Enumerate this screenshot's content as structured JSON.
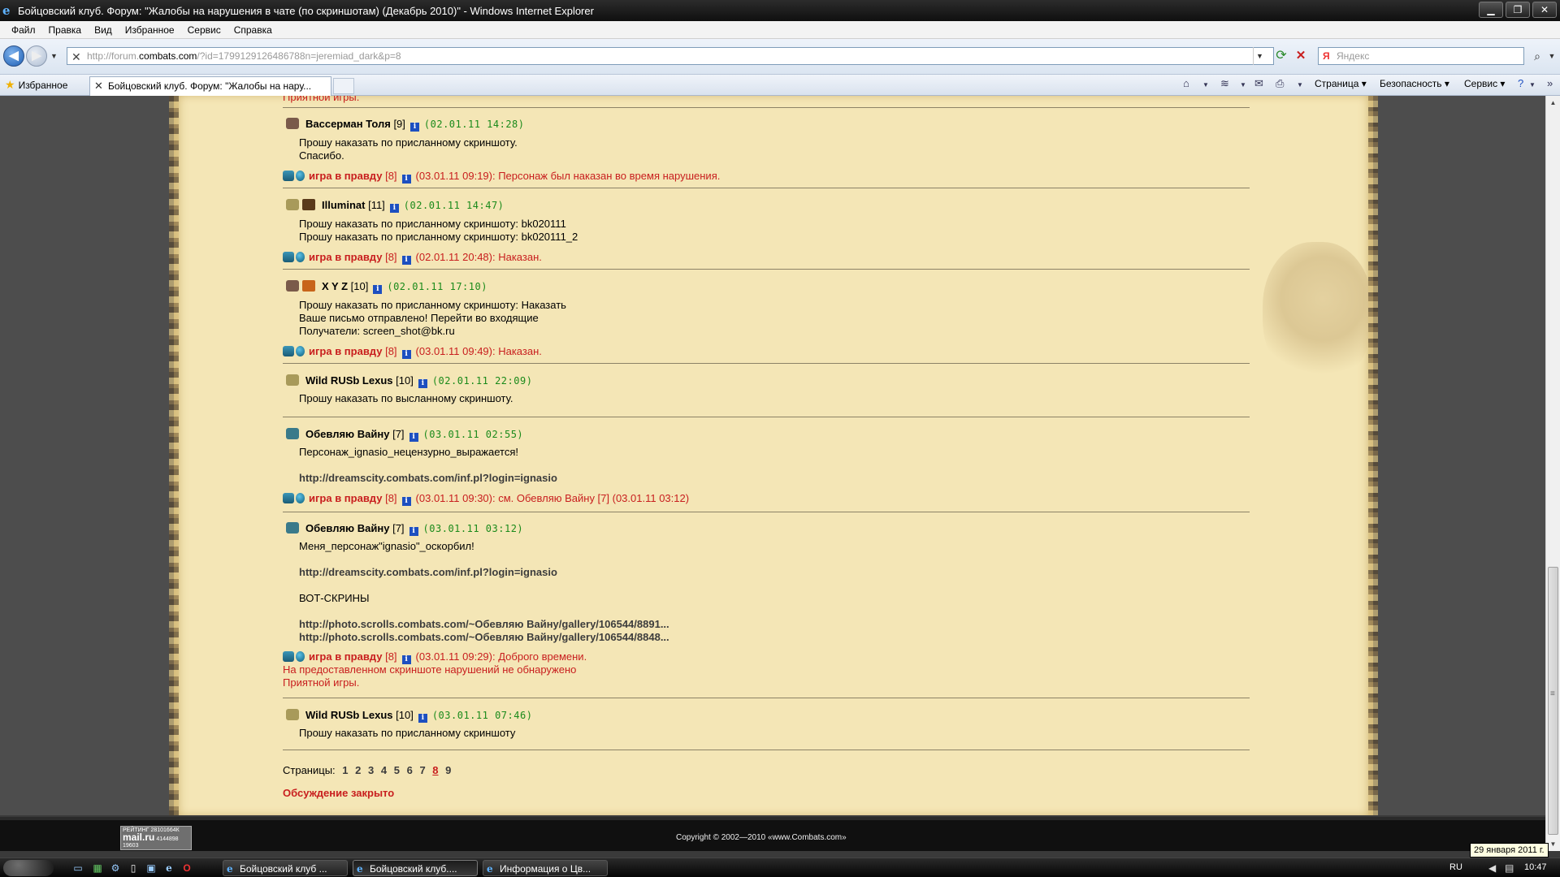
{
  "window": {
    "title": "Бойцовский клуб. Форум: \"Жалобы на нарушения в чате (по скриншотам) (Декабрь 2010)\" - Windows Internet Explorer"
  },
  "menu": [
    "Файл",
    "Правка",
    "Вид",
    "Избранное",
    "Сервис",
    "Справка"
  ],
  "address": {
    "prefix": "http://forum.",
    "host": "combats.com",
    "suffix": "/?id=1799129126486788n=jeremiad_dark&p=8",
    "search_placeholder": "Яндекс"
  },
  "tabs": {
    "favorites_label": "Избранное",
    "active_tab": "Бойцовский клуб. Форум: \"Жалобы на нару..."
  },
  "commandbar": {
    "page": "Страница",
    "security": "Безопасность",
    "service": "Сервис"
  },
  "forum": {
    "top_cut": "Приятной игры.",
    "posts": [
      {
        "author": "Вассерман Толя",
        "level": "[9]",
        "date": "(02.01.11 14:28)",
        "body": "Прошу наказать по присланному скриншоту.\nСпасибо.",
        "reply": {
          "moderator": "игра в правду",
          "level": "[8]",
          "text": "(03.01.11 09:19): Персонаж был наказан во время нарушения."
        }
      },
      {
        "author": "Illuminat",
        "level": "[11]",
        "date": "(02.01.11 14:47)",
        "body": "Прошу наказать по присланному скриншоту: bk020111\nПрошу наказать по присланному скриншоту: bk020111_2",
        "reply": {
          "moderator": "игра в правду",
          "level": "[8]",
          "text": "(02.01.11 20:48): Наказан."
        }
      },
      {
        "author": "X Y Z",
        "level": "[10]",
        "date": "(02.01.11 17:10)",
        "body": "Прошу наказать по присланному скриншоту: Наказать\nВаше письмо отправлено! Перейти во входящие\nПолучатели: screen_shot@bk.ru",
        "reply": {
          "moderator": "игра в правду",
          "level": "[8]",
          "text": "(03.01.11 09:49): Наказан."
        }
      },
      {
        "author": "Wild RUSb Lexus",
        "level": "[10]",
        "date": "(02.01.11 22:09)",
        "body": "Прошу наказать по высланному скриншоту."
      },
      {
        "author": "Обевляю Вайну",
        "level": "[7]",
        "date": "(03.01.11 02:55)",
        "body": "Персонаж_ignasio_нецензурно_выражается!",
        "link1": "http://dreamscity.combats.com/inf.pl?login=ignasio",
        "reply": {
          "moderator": "игра в правду",
          "level": "[8]",
          "text": "(03.01.11 09:30): см. Обевляю Вайну [7]   (03.01.11 03:12)"
        }
      },
      {
        "author": "Обевляю Вайну",
        "level": "[7]",
        "date": "(03.01.11 03:12)",
        "body": "Меня_персонаж\"ignasio\"_оскорбил!",
        "link1": "http://dreamscity.combats.com/inf.pl?login=ignasio",
        "screens_label": "ВОТ-СКРИНЫ",
        "link2": "http://photo.scrolls.combats.com/~Обевляю Вайну/gallery/106544/8891...",
        "link3": "http://photo.scrolls.combats.com/~Обевляю Вайну/gallery/106544/8848...",
        "reply": {
          "moderator": "игра в правду",
          "level": "[8]",
          "text": "(03.01.11 09:29): Доброго времени.",
          "extra": "На предоставленном скриншоте нарушений не обнаружено\nПриятной игры."
        }
      },
      {
        "author": "Wild RUSb Lexus",
        "level": "[10]",
        "date": "(03.01.11 07:46)",
        "body": "Прошу наказать по присланному скриншоту"
      }
    ],
    "pages_label": "Страницы:",
    "pages": [
      "1",
      "2",
      "3",
      "4",
      "5",
      "6",
      "7",
      "8",
      "9"
    ],
    "current_page": "8",
    "closed_text": "Обсуждение закрыто"
  },
  "footer": {
    "copyright": "Copyright © 2002—2010 «www.Combats.com»",
    "counter_top": "РЕЙТИНГ 28101664К",
    "counter_brand": "mail.ru",
    "counter_n1": "4144898",
    "counter_n2": "19603"
  },
  "tooltip": "29 января 2011 г.",
  "taskbar": {
    "tasks": [
      "Бойцовский клуб ...",
      "Бойцовский клуб....",
      "Информация о Цв..."
    ],
    "lang": "RU",
    "clock": "10:47"
  }
}
